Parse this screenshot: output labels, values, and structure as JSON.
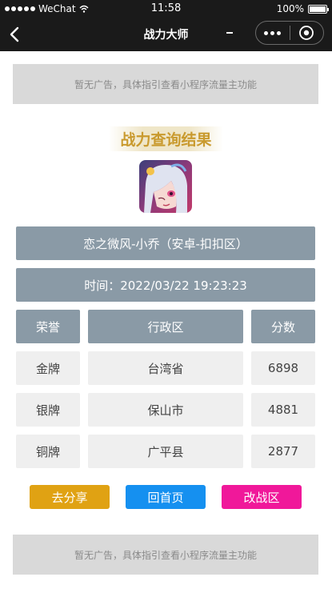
{
  "statusbar": {
    "carrier": "WeChat",
    "time": "11:58",
    "battery": "100%"
  },
  "navbar": {
    "title": "战力大师",
    "back_icon": "chevron-left-icon",
    "more_icon": "more-dots-icon",
    "close_icon": "target-circle-icon"
  },
  "ads": {
    "top": "暂无广告，具体指引查看小程序流量主功能",
    "bottom": "暂无广告，具体指引查看小程序流量主功能"
  },
  "result": {
    "title": "战力查询结果",
    "hero_name": "恋之微风-小乔（安卓-扣扣区）",
    "time": "时间：2022/03/22 19:23:23"
  },
  "table": {
    "headers": [
      "荣誉",
      "行政区",
      "分数"
    ],
    "rows": [
      [
        "金牌",
        "台湾省",
        "6898"
      ],
      [
        "银牌",
        "保山市",
        "4881"
      ],
      [
        "铜牌",
        "广平县",
        "2877"
      ]
    ]
  },
  "buttons": {
    "share": "去分享",
    "home": "回首页",
    "change": "改战区"
  },
  "colors": {
    "accent_gold": "#c99a2e",
    "header_gray": "#8a9aa6",
    "share": "#e0a213",
    "home": "#1590f0",
    "change": "#f0189a"
  }
}
